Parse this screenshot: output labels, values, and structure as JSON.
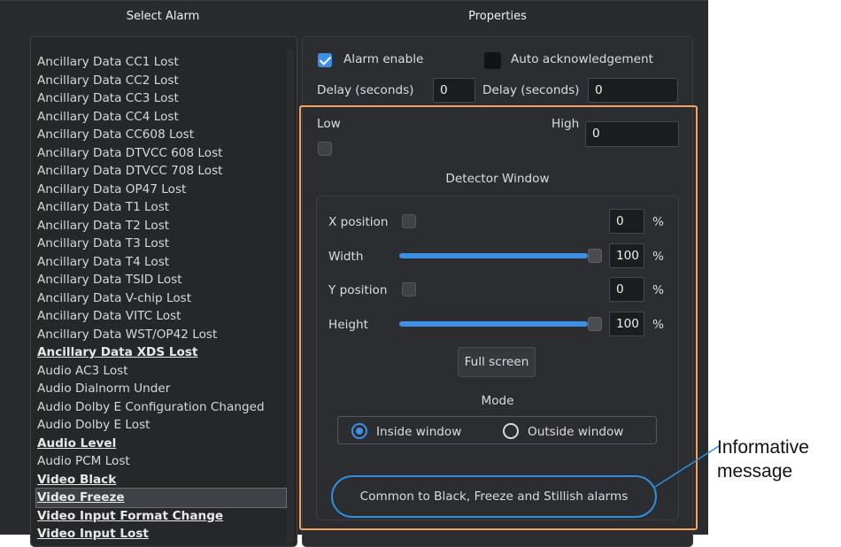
{
  "select_alarm": {
    "heading": "Select Alarm",
    "items": [
      {
        "label": "Ancillary Data CC1 Lost",
        "bold": false,
        "selected": false
      },
      {
        "label": "Ancillary Data CC2 Lost",
        "bold": false,
        "selected": false
      },
      {
        "label": "Ancillary Data CC3 Lost",
        "bold": false,
        "selected": false
      },
      {
        "label": "Ancillary Data CC4 Lost",
        "bold": false,
        "selected": false
      },
      {
        "label": "Ancillary Data CC608 Lost",
        "bold": false,
        "selected": false
      },
      {
        "label": "Ancillary Data DTVCC 608 Lost",
        "bold": false,
        "selected": false
      },
      {
        "label": "Ancillary Data DTVCC 708 Lost",
        "bold": false,
        "selected": false
      },
      {
        "label": "Ancillary Data OP47 Lost",
        "bold": false,
        "selected": false
      },
      {
        "label": "Ancillary Data T1 Lost",
        "bold": false,
        "selected": false
      },
      {
        "label": "Ancillary Data T2 Lost",
        "bold": false,
        "selected": false
      },
      {
        "label": "Ancillary Data T3 Lost",
        "bold": false,
        "selected": false
      },
      {
        "label": "Ancillary Data T4 Lost",
        "bold": false,
        "selected": false
      },
      {
        "label": "Ancillary Data TSID Lost",
        "bold": false,
        "selected": false
      },
      {
        "label": "Ancillary Data V-chip Lost",
        "bold": false,
        "selected": false
      },
      {
        "label": "Ancillary Data VITC Lost",
        "bold": false,
        "selected": false
      },
      {
        "label": "Ancillary Data WST/OP42 Lost",
        "bold": false,
        "selected": false
      },
      {
        "label": "Ancillary Data XDS Lost",
        "bold": true,
        "selected": false
      },
      {
        "label": "Audio AC3 Lost",
        "bold": false,
        "selected": false
      },
      {
        "label": "Audio Dialnorm Under",
        "bold": false,
        "selected": false
      },
      {
        "label": "Audio Dolby E Configuration Changed",
        "bold": false,
        "selected": false
      },
      {
        "label": "Audio Dolby E Lost",
        "bold": false,
        "selected": false
      },
      {
        "label": "Audio Level",
        "bold": true,
        "selected": false
      },
      {
        "label": "Audio PCM Lost",
        "bold": false,
        "selected": false
      },
      {
        "label": "Video Black",
        "bold": true,
        "selected": false
      },
      {
        "label": "Video Freeze",
        "bold": true,
        "selected": true
      },
      {
        "label": "Video Input Format Change",
        "bold": true,
        "selected": false
      },
      {
        "label": "Video Input Lost",
        "bold": true,
        "selected": false
      }
    ]
  },
  "properties": {
    "heading": "Properties",
    "alarm_enable_label": "Alarm enable",
    "alarm_enable_checked": true,
    "auto_ack_label": "Auto acknowledgement",
    "auto_ack_checked": false,
    "delay_label_1": "Delay (seconds)",
    "delay_value_1": "0",
    "delay_label_2": "Delay (seconds)",
    "delay_value_2": "0",
    "low_label": "Low",
    "low_checked": false,
    "high_label": "High",
    "high_value": "0"
  },
  "detector": {
    "heading": "Detector Window",
    "x_label": "X position",
    "x_value": "0",
    "width_label": "Width",
    "width_value": "100",
    "width_level": 1.0,
    "y_label": "Y position",
    "y_value": "0",
    "height_label": "Height",
    "height_value": "100",
    "height_level": 1.0,
    "percent": "%",
    "full_screen_label": "Full screen"
  },
  "mode": {
    "heading": "Mode",
    "inside_label": "Inside window",
    "outside_label": "Outside window",
    "selected": "inside"
  },
  "message": "Common to Black, Freeze and Stillish alarms",
  "callout": {
    "line1": "Informative",
    "line2": "message"
  },
  "colors": {
    "accent": "#3d8fe3",
    "highlight": "#f4a460",
    "callout_line": "#2f8ddc"
  }
}
